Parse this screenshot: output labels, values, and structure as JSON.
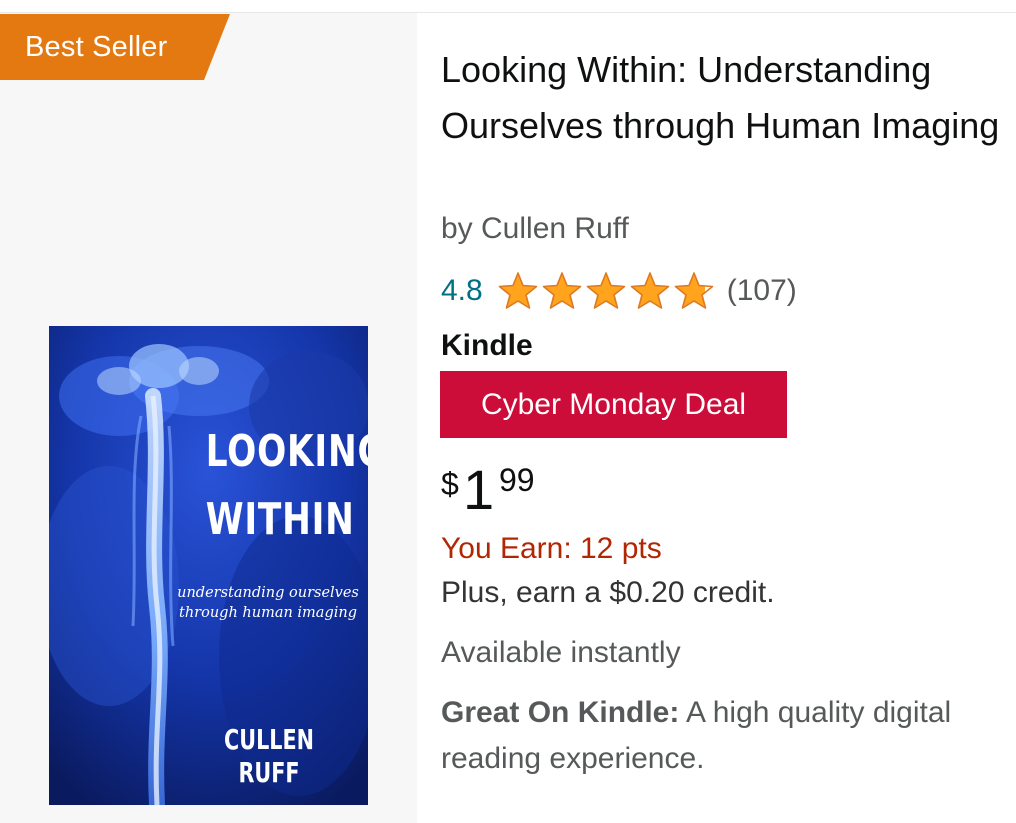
{
  "badge": {
    "label": "Best Seller",
    "color": "#e47911"
  },
  "cover": {
    "title_line1": "LOOKING",
    "title_line2": "WITHIN",
    "subtitle_line1": "understanding ourselves",
    "subtitle_line2": "through human imaging",
    "author": "CULLEN RUFF"
  },
  "product": {
    "title": "Looking Within: Understanding Ourselves through Human Imaging",
    "author_line": "by Cullen Ruff",
    "rating": {
      "value": "4.8",
      "stars": 4.8,
      "max": 5,
      "count": "(107)",
      "star_color": "#ffa41c"
    },
    "format": "Kindle",
    "deal_label": "Cyber Monday Deal",
    "deal_color": "#cc0c39",
    "price": {
      "symbol": "$",
      "whole": "1",
      "fraction": "99"
    },
    "earn_text": "You Earn: 12 pts",
    "credit_text": "Plus, earn a $0.20 credit.",
    "availability": "Available instantly",
    "feature": {
      "label": "Great On Kindle:",
      "text": " A high quality digital reading experience."
    }
  }
}
